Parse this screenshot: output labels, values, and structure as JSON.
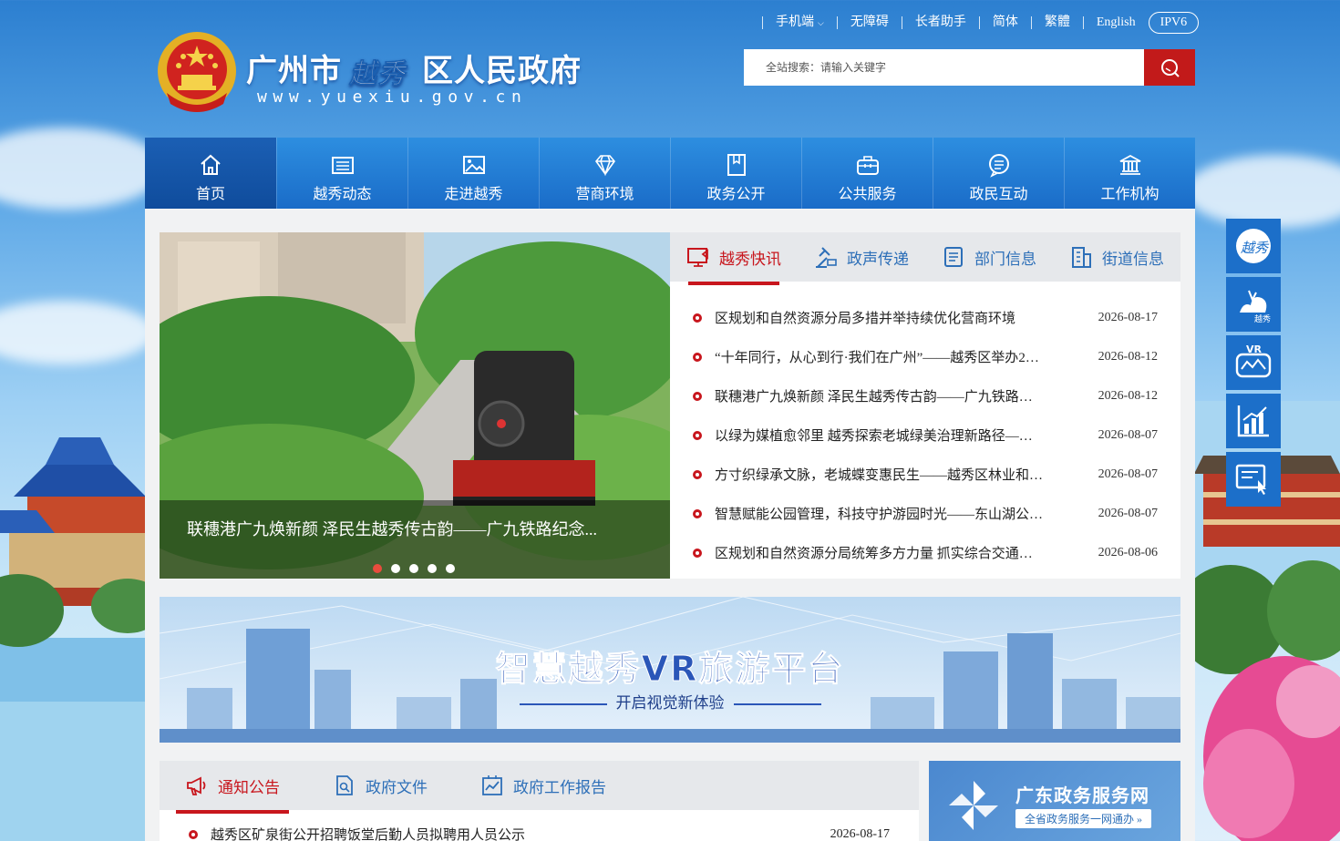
{
  "colors": {
    "nav_bg": "#1a6cc8",
    "accent_red": "#c8161d",
    "link_blue": "#2d6fb8",
    "panel_bg": "#f1f2f3"
  },
  "top_links": [
    {
      "label": "手机端",
      "has_dropdown": true
    },
    {
      "label": "无障碍"
    },
    {
      "label": "长者助手"
    },
    {
      "label": "简体"
    },
    {
      "label": "繁體"
    },
    {
      "label": "English"
    }
  ],
  "ipv6": "IPV6",
  "header": {
    "title_left": "广州市",
    "title_seal": "越秀",
    "title_right": "区人民政府",
    "url": "www.yuexiu.gov.cn"
  },
  "search": {
    "placeholder": "全站搜索：请输入关键字",
    "value": "",
    "icon": "search-icon"
  },
  "nav": [
    {
      "label": "首页",
      "icon": "home-icon",
      "active": true
    },
    {
      "label": "越秀动态",
      "icon": "newspaper-icon"
    },
    {
      "label": "走进越秀",
      "icon": "picture-icon"
    },
    {
      "label": "营商环境",
      "icon": "diamond-icon"
    },
    {
      "label": "政务公开",
      "icon": "bookmark-doc-icon"
    },
    {
      "label": "公共服务",
      "icon": "briefcase-icon"
    },
    {
      "label": "政民互动",
      "icon": "chat-icon"
    },
    {
      "label": "工作机构",
      "icon": "institution-icon"
    }
  ],
  "slider": {
    "caption": "联穗港广九焕新颜 泽民生越秀传古韵——广九铁路纪念...",
    "dots": 5,
    "active_dot": 1
  },
  "news_tabs": [
    {
      "label": "越秀快讯",
      "icon": "screen-icon",
      "active": true
    },
    {
      "label": "政声传递",
      "icon": "gavel-icon"
    },
    {
      "label": "部门信息",
      "icon": "document-icon"
    },
    {
      "label": "街道信息",
      "icon": "building-icon"
    }
  ],
  "news": [
    {
      "title": "区规划和自然资源分局多措并举持续优化营商环境",
      "date": "2026-08-17"
    },
    {
      "title": "“十年同行，从心到行·我们在广州”——越秀区举办2…",
      "date": "2026-08-12"
    },
    {
      "title": "联穗港广九焕新颜 泽民生越秀传古韵——广九铁路…",
      "date": "2026-08-12"
    },
    {
      "title": "以绿为媒植愈邻里 越秀探索老城绿美治理新路径—…",
      "date": "2026-08-07"
    },
    {
      "title": "方寸织绿承文脉，老城蝶变惠民生——越秀区林业和…",
      "date": "2026-08-07"
    },
    {
      "title": "智慧赋能公园管理，科技守护游园时光——东山湖公…",
      "date": "2026-08-07"
    },
    {
      "title": "区规划和自然资源分局统筹多方力量 抓实综合交通…",
      "date": "2026-08-06"
    }
  ],
  "banner": {
    "title": "智慧越秀VR旅游平台",
    "subtitle": "开启视觉新体验"
  },
  "notice_tabs": [
    {
      "label": "通知公告",
      "icon": "megaphone-icon",
      "active": true
    },
    {
      "label": "政府文件",
      "icon": "file-search-icon"
    },
    {
      "label": "政府工作报告",
      "icon": "chart-report-icon"
    }
  ],
  "notice_first": {
    "title": "越秀区矿泉街公开招聘饭堂后勤人员拟聘用人员公示",
    "date": "2026-08-17"
  },
  "gd_service": {
    "title": "广东政务服务网",
    "subtitle": "全省政务服务一网通办"
  },
  "side_buttons": [
    {
      "icon": "yuexiu-logo-icon"
    },
    {
      "icon": "yuexiu-culture-icon"
    },
    {
      "icon": "vr-icon"
    },
    {
      "icon": "statistics-icon"
    },
    {
      "icon": "online-service-icon"
    }
  ]
}
